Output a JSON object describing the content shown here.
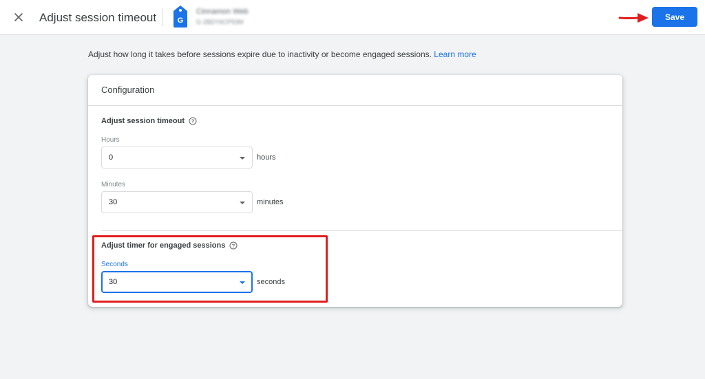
{
  "header": {
    "title": "Adjust session timeout",
    "property_name": "Cinnamon Web",
    "property_id": "G-2BDY6CP93M",
    "save_label": "Save"
  },
  "description": {
    "text": "Adjust how long it takes before sessions expire due to inactivity or become engaged sessions.",
    "learn_more": "Learn more"
  },
  "card": {
    "title": "Configuration",
    "session_timeout": {
      "title": "Adjust session timeout",
      "hours": {
        "label": "Hours",
        "value": "0",
        "unit": "hours"
      },
      "minutes": {
        "label": "Minutes",
        "value": "30",
        "unit": "minutes"
      }
    },
    "engaged": {
      "title": "Adjust timer for engaged sessions",
      "seconds": {
        "label": "Seconds",
        "value": "30",
        "unit": "seconds"
      }
    }
  },
  "colors": {
    "accent": "#1a73e8",
    "annotation": "#e11d1d"
  },
  "icons": [
    "close-icon",
    "property-tag-icon",
    "help-icon",
    "chevron-down-icon",
    "arrow-right-icon"
  ]
}
